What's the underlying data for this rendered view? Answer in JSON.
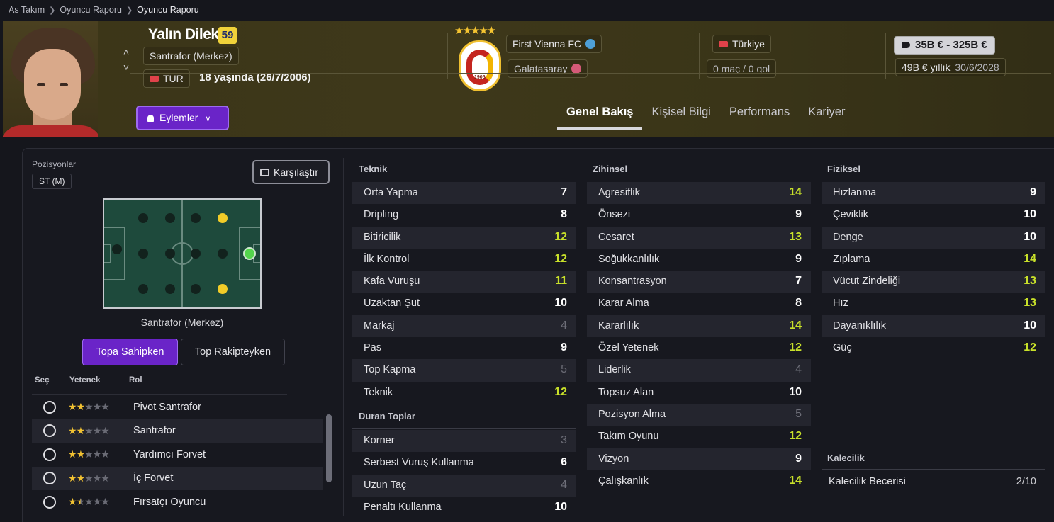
{
  "breadcrumb": {
    "items": [
      "As Takım",
      "Oyuncu Raporu",
      "Oyuncu Raporu"
    ]
  },
  "player": {
    "name": "Yalın Dilek",
    "rating": "59",
    "position": "Santrafor (Merkez)",
    "nationality_code": "TUR",
    "age_text": "18 yaşında (26/7/2006)",
    "current_club": "First Vienna FC",
    "parent_club": "Galatasaray",
    "crest_year": "1905",
    "national_team": "Türkiye",
    "caps_text": "0 maç / 0 gol",
    "value_range": "35B € - 325B €",
    "wage_text": "49B € yıllık",
    "contract_end": "30/6/2028"
  },
  "actions": {
    "label": "Eylemler"
  },
  "tabs": [
    {
      "label": "Genel Bakış",
      "active": true
    },
    {
      "label": "Kişisel Bilgi"
    },
    {
      "label": "Performans"
    },
    {
      "label": "Kariyer"
    }
  ],
  "positions": {
    "label": "Pozisyonlar",
    "chip": "ST (M)",
    "caption": "Santrafor (Merkez)"
  },
  "compare": {
    "label": "Karşılaştır"
  },
  "toggle": {
    "on": "Topa Sahipken",
    "off": "Top Rakipteyken"
  },
  "roles": {
    "headers": {
      "select": "Seç",
      "skill": "Yetenek",
      "role": "Rol"
    },
    "items": [
      {
        "name": "Pivot Santrafor",
        "stars": 2
      },
      {
        "name": "Santrafor",
        "stars": 2
      },
      {
        "name": "Yardımcı Forvet",
        "stars": 2
      },
      {
        "name": "İç Forvet",
        "stars": 2
      },
      {
        "name": "Fırsatçı Oyuncu",
        "stars": 1.5
      }
    ]
  },
  "sections": {
    "teknik": {
      "title": "Teknik",
      "rows": [
        {
          "name": "Orta Yapma",
          "value": "7"
        },
        {
          "name": "Dripling",
          "value": "8"
        },
        {
          "name": "Bitiricilik",
          "value": "12"
        },
        {
          "name": "İlk Kontrol",
          "value": "12"
        },
        {
          "name": "Kafa Vuruşu",
          "value": "11"
        },
        {
          "name": "Uzaktan Şut",
          "value": "10"
        },
        {
          "name": "Markaj",
          "value": "4"
        },
        {
          "name": "Pas",
          "value": "9"
        },
        {
          "name": "Top Kapma",
          "value": "5"
        },
        {
          "name": "Teknik",
          "value": "12"
        }
      ]
    },
    "duran": {
      "title": "Duran Toplar",
      "rows": [
        {
          "name": "Korner",
          "value": "3"
        },
        {
          "name": "Serbest Vuruş Kullanma",
          "value": "6"
        },
        {
          "name": "Uzun Taç",
          "value": "4"
        },
        {
          "name": "Penaltı Kullanma",
          "value": "10"
        }
      ]
    },
    "zihinsel": {
      "title": "Zihinsel",
      "rows": [
        {
          "name": "Agresiflik",
          "value": "14"
        },
        {
          "name": "Önsezi",
          "value": "9"
        },
        {
          "name": "Cesaret",
          "value": "13"
        },
        {
          "name": "Soğukkanlılık",
          "value": "9"
        },
        {
          "name": "Konsantrasyon",
          "value": "7"
        },
        {
          "name": "Karar Alma",
          "value": "8"
        },
        {
          "name": "Kararlılık",
          "value": "14"
        },
        {
          "name": "Özel Yetenek",
          "value": "12"
        },
        {
          "name": "Liderlik",
          "value": "4"
        },
        {
          "name": "Topsuz Alan",
          "value": "10"
        },
        {
          "name": "Pozisyon Alma",
          "value": "5"
        },
        {
          "name": "Takım Oyunu",
          "value": "12"
        },
        {
          "name": "Vizyon",
          "value": "9"
        },
        {
          "name": "Çalışkanlık",
          "value": "14"
        }
      ]
    },
    "fiziksel": {
      "title": "Fiziksel",
      "rows": [
        {
          "name": "Hızlanma",
          "value": "9"
        },
        {
          "name": "Çeviklik",
          "value": "10"
        },
        {
          "name": "Denge",
          "value": "10"
        },
        {
          "name": "Zıplama",
          "value": "14"
        },
        {
          "name": "Vücut Zindeliği",
          "value": "13"
        },
        {
          "name": "Hız",
          "value": "13"
        },
        {
          "name": "Dayanıklılık",
          "value": "10"
        },
        {
          "name": "Güç",
          "value": "12"
        }
      ]
    },
    "kalecilik": {
      "title": "Kalecilik",
      "rows": [
        {
          "name": "Kalecilik Becerisi",
          "value": "2/10"
        }
      ]
    }
  },
  "colors": {
    "accent": "#6a24c8",
    "high_value": "#c8e02a",
    "low_value": "#6d6e78",
    "rating_badge": "#f0d23a"
  },
  "icons": [
    "chevron-right-icon",
    "chevron-up-icon",
    "chevron-down-icon",
    "person-icon",
    "compare-icon",
    "tag-icon",
    "star-icon",
    "flag-icon"
  ]
}
